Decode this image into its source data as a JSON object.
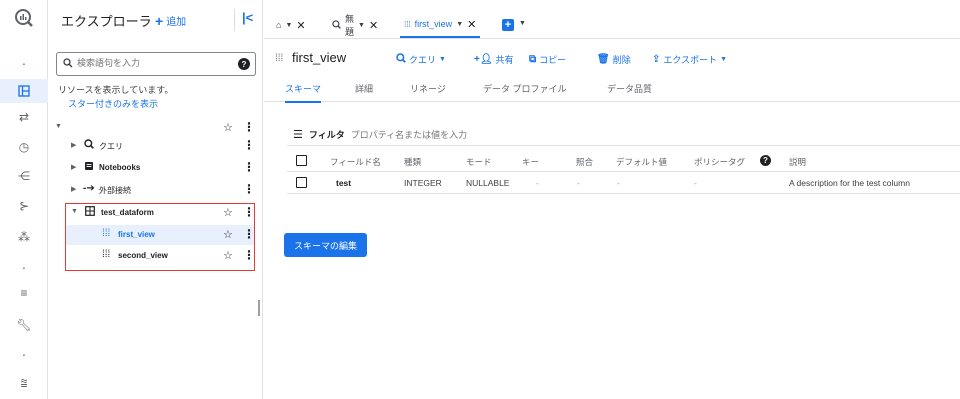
{
  "rail": {
    "items": [
      "logo-icon",
      "dot",
      "explorer-icon",
      "transfer-icon",
      "history-icon",
      "pipeline-icon",
      "dataflow-icon",
      "graph-icon",
      "dot",
      "list-icon",
      "wrench-icon",
      "dot",
      "chart-icon"
    ]
  },
  "explorer": {
    "title": "エクスプローラ",
    "add_label": "追加",
    "search_placeholder": "検索語句を入力",
    "info_text": "リソースを表示しています。",
    "starred_link": "スター付きのみを表示",
    "tree": [
      {
        "label": "クエリ",
        "icon": "query-icon"
      },
      {
        "label": "Notebooks",
        "icon": "notebook-icon"
      },
      {
        "label": "外部接続",
        "icon": "connection-icon"
      },
      {
        "label": "test_dataform",
        "icon": "dataset-icon"
      },
      {
        "label": "first_view",
        "icon": "view-icon"
      },
      {
        "label": "second_view",
        "icon": "view-icon"
      }
    ]
  },
  "tabs": [
    {
      "label": "",
      "icon": "home-icon"
    },
    {
      "label": "無題",
      "icon": "query-icon"
    },
    {
      "label": "first_view",
      "icon": "view-icon"
    }
  ],
  "toolbar": {
    "title": "first_view",
    "query_label": "クエリ",
    "share_label": "共有",
    "copy_label": "コピー",
    "delete_label": "削除",
    "export_label": "エクスポート"
  },
  "subtabs": [
    "スキーマ",
    "詳細",
    "リネージ",
    "データ プロファイル",
    "データ品質"
  ],
  "filter": {
    "label": "フィルタ",
    "placeholder": "プロパティ名または値を入力"
  },
  "schema": {
    "headers": [
      "フィールド名",
      "種類",
      "モード",
      "キー",
      "照合",
      "デフォルト値",
      "ポリシータグ",
      "説明"
    ],
    "rows": [
      [
        "test",
        "INTEGER",
        "NULLABLE",
        "-",
        "-",
        "-",
        "-",
        "A description for the test column"
      ]
    ]
  },
  "edit_schema_label": "スキーマの編集",
  "colors": {
    "accent": "#1a73e8",
    "highlight": "#e53935",
    "selected_bg": "#e8f0fe"
  }
}
